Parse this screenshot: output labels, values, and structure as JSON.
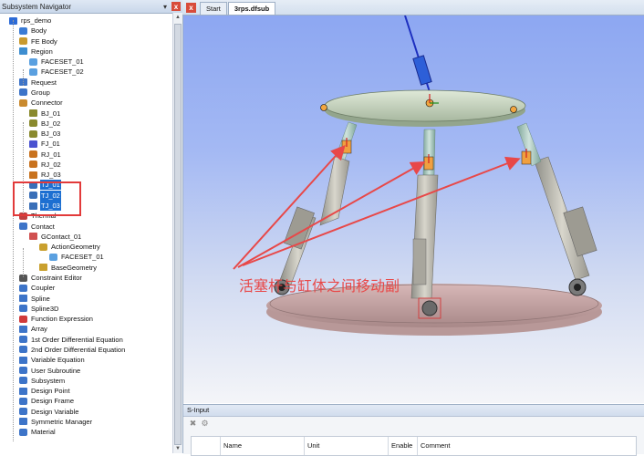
{
  "navigator": {
    "title": "Subsystem Navigator",
    "pin_icon": "pin-icon",
    "close_label": "x",
    "items": [
      {
        "label": "rps_demo",
        "icon": "model-icon",
        "color": "#2d6bd6"
      },
      {
        "label": "Body",
        "icon": "body-icon",
        "color": "#3a7bd5"
      },
      {
        "label": "FE Body",
        "icon": "fe-body-icon",
        "color": "#c99a2e"
      },
      {
        "label": "Region",
        "icon": "region-icon",
        "color": "#3e8ed0"
      },
      {
        "label": "FACESET_01",
        "icon": "faceset-icon",
        "color": "#5aa0e0"
      },
      {
        "label": "FACESET_02",
        "icon": "faceset-icon",
        "color": "#5aa0e0"
      },
      {
        "label": "Request",
        "icon": "request-icon",
        "color": "#3d74c8"
      },
      {
        "label": "Group",
        "icon": "group-icon",
        "color": "#3d74c8"
      },
      {
        "label": "Connector",
        "icon": "connector-icon",
        "color": "#c98a2e"
      },
      {
        "label": "BJ_01",
        "icon": "ball-joint-icon",
        "color": "#8a8a2e"
      },
      {
        "label": "BJ_02",
        "icon": "ball-joint-icon",
        "color": "#8a8a2e"
      },
      {
        "label": "BJ_03",
        "icon": "ball-joint-icon",
        "color": "#8a8a2e"
      },
      {
        "label": "FJ_01",
        "icon": "fixed-joint-icon",
        "color": "#4a52d0"
      },
      {
        "label": "RJ_01",
        "icon": "revolute-joint-icon",
        "color": "#c8721e"
      },
      {
        "label": "RJ_02",
        "icon": "revolute-joint-icon",
        "color": "#c8721e"
      },
      {
        "label": "RJ_03",
        "icon": "revolute-joint-icon",
        "color": "#c8721e"
      },
      {
        "label": "TJ_01",
        "icon": "translational-joint-icon",
        "color": "#3a6fb8"
      },
      {
        "label": "TJ_02",
        "icon": "translational-joint-icon",
        "color": "#3a6fb8"
      },
      {
        "label": "TJ_03",
        "icon": "translational-joint-icon",
        "color": "#3a6fb8"
      },
      {
        "label": "Thermal",
        "icon": "thermal-icon",
        "color": "#c04040"
      },
      {
        "label": "Contact",
        "icon": "contact-icon",
        "color": "#3d74c8"
      },
      {
        "label": "GContact_01",
        "icon": "gcontact-icon",
        "color": "#d05050"
      },
      {
        "label": "ActionGeometry",
        "icon": "geometry-icon",
        "color": "#c9a02e"
      },
      {
        "label": "FACESET_01",
        "icon": "faceset-icon",
        "color": "#5aa0e0"
      },
      {
        "label": "BaseGeometry",
        "icon": "geometry-icon",
        "color": "#c9a02e"
      },
      {
        "label": "Constraint Editor",
        "icon": "constraint-icon",
        "color": "#555555"
      },
      {
        "label": "Coupler",
        "icon": "coupler-icon",
        "color": "#3d74c8"
      },
      {
        "label": "Spline",
        "icon": "spline-icon",
        "color": "#3d74c8"
      },
      {
        "label": "Spline3D",
        "icon": "spline3d-icon",
        "color": "#3d74c8"
      },
      {
        "label": "Function Expression",
        "icon": "function-icon",
        "color": "#d03a3a"
      },
      {
        "label": "Array",
        "icon": "array-icon",
        "color": "#3d74c8"
      },
      {
        "label": "1st Order Differential Equation",
        "icon": "ode1-icon",
        "color": "#3d74c8"
      },
      {
        "label": "2nd Order Differential Equation",
        "icon": "ode2-icon",
        "color": "#3d74c8"
      },
      {
        "label": "Variable Equation",
        "icon": "variable-equation-icon",
        "color": "#3d74c8"
      },
      {
        "label": "User Subroutine",
        "icon": "user-subroutine-icon",
        "color": "#3d74c8"
      },
      {
        "label": "Subsystem",
        "icon": "subsystem-icon",
        "color": "#3d74c8"
      },
      {
        "label": "Design Point",
        "icon": "design-point-icon",
        "color": "#3d74c8"
      },
      {
        "label": "Design Frame",
        "icon": "design-frame-icon",
        "color": "#3d74c8"
      },
      {
        "label": "Design Variable",
        "icon": "design-variable-icon",
        "color": "#3d74c8"
      },
      {
        "label": "Symmetric Manager",
        "icon": "symmetric-manager-icon",
        "color": "#3d74c8"
      },
      {
        "label": "Material",
        "icon": "material-icon",
        "color": "#3d74c8"
      }
    ],
    "selected": [
      "TJ_01",
      "TJ_02",
      "TJ_03"
    ]
  },
  "tabs": {
    "close_label": "x",
    "items": [
      {
        "label": "Start",
        "active": false
      },
      {
        "label": "3rps.dfsub",
        "active": true
      }
    ]
  },
  "viewport": {
    "annotation": "活塞杆与缸体之间移动副",
    "annotation_color": "#e84848",
    "sky_top": "#8da7f2",
    "sky_bottom": "#f4f5f8"
  },
  "sinput": {
    "title": "S-Input",
    "tools": [
      "delete-icon",
      "link-icon"
    ],
    "columns": [
      "Name",
      "Unit",
      "Enable",
      "Comment"
    ]
  }
}
